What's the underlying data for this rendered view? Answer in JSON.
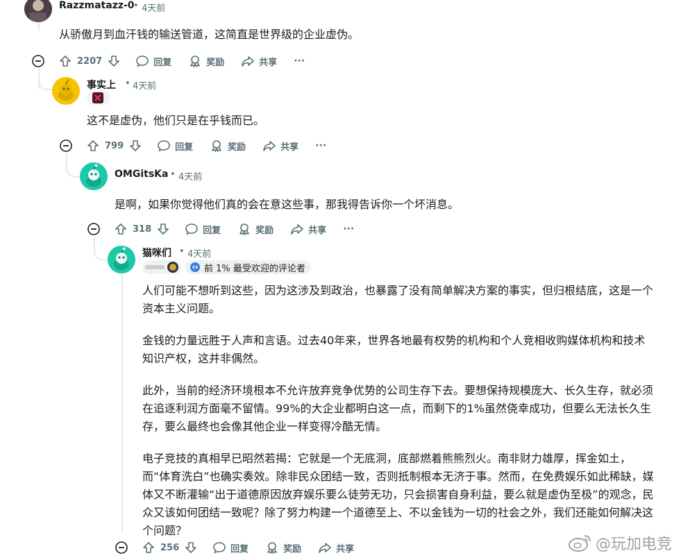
{
  "comments": [
    {
      "author": "Razzmatazz-0",
      "time": "4天前",
      "body": [
        "从骄傲月到血汗钱的输送管道，这简直是世界级的企业虚伪。"
      ],
      "upvotes": "2207"
    },
    {
      "author": "事实上",
      "time": "4天前",
      "body": [
        "这不是虚伪，他们只是在乎钱而已。"
      ],
      "upvotes": "799"
    },
    {
      "author": "OMGitsKa",
      "time": "4天前",
      "body": [
        "是啊，如果你觉得他们真的会在意这些事，那我得告诉你一个坏消息。"
      ],
      "upvotes": "318"
    },
    {
      "author": "猫咪们",
      "time": "4天前",
      "badge": "前 1% 最受欢迎的评论者",
      "body": [
        "人们可能不想听到这些，因为这涉及到政治，也暴露了没有简单解决方案的事实，但归根结底，这是一个资本主义问题。",
        "金钱的力量远胜于人声和言语。过去40年来，世界各地最有权势的机构和个人竞相收购媒体机构和技术知识产权，这并非偶然。",
        "此外，当前的经济环境根本不允许放弃竞争优势的公司生存下去。要想保持规模庞大、长久生存，就必须在追逐利润方面毫不留情。99%的大企业都明白这一点，而剩下的1%虽然侥幸成功，但要么无法长久生存，要么最终也会像其他企业一样变得冷酷无情。",
        "电子竞技的真相早已昭然若揭：它就是一个无底洞，底部燃着熊熊烈火。南非财力雄厚，挥金如土，而“体育洗白”也确实奏效。除非民众团结一致，否则抵制根本无济于事。然而，在免费娱乐如此稀缺，媒体又不断灌输“出于道德原因放弃娱乐要么徒劳无功，只会损害自身利益，要么就是虚伪至极”的观念，民众又该如何团结一致呢？除了努力构建一个道德至上、不以金钱为一切的社会之外，我们还能如何解决这个问题？"
      ],
      "upvotes": "256"
    }
  ],
  "actions": {
    "reply": "回复",
    "award": "奖励",
    "share": "共享",
    "more": "···"
  },
  "separator": "•",
  "watermark": "@玩加电竞",
  "icons": [
    "upvote-icon",
    "downvote-icon",
    "comment-icon",
    "award-icon",
    "share-icon",
    "more-icon",
    "collapse-icon",
    "snoo-avatar-icon",
    "weibo-icon",
    "popular-commenter-icon"
  ],
  "colors": {
    "meta": "#576f76",
    "thread": "#e5e7ea",
    "avatar_yellow": "#f5c400",
    "avatar_teal": "#1dc9a8"
  }
}
